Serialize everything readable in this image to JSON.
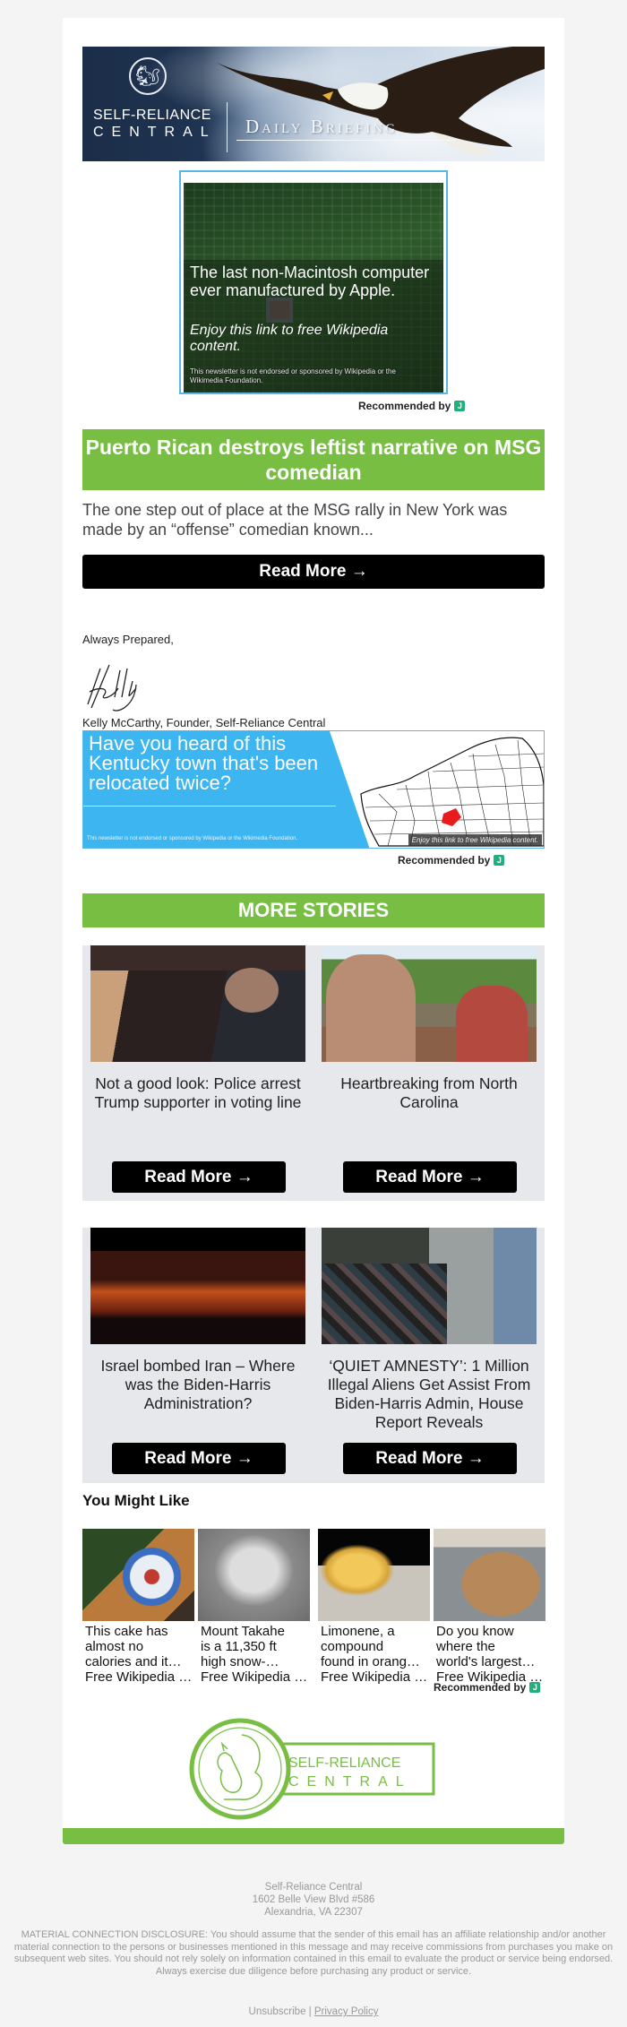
{
  "banner": {
    "brand_line1": "SELF-RELIANCE",
    "brand_line2": "CENTRAL",
    "title": "Daily Briefing"
  },
  "ad_top": {
    "title": "The last non-Macintosh computer ever manufactured by Apple.",
    "subtitle": "Enjoy this link to free Wikipedia content.",
    "disclaimer": "This newsletter is not endorsed or sponsored by Wikipedia or the Wikimedia Foundation.",
    "recommended_by": "Recommended by",
    "provider_icon": "J"
  },
  "main_story": {
    "headline": "Puerto Rican destroys leftist narrative on MSG comedian",
    "teaser": "The one step out of place at the MSG rally in New York was made by an “offense” comedian known...",
    "read_more": "Read More →"
  },
  "signoff": {
    "closing": "Always Prepared,",
    "signature": "Kelly",
    "name_line": "Kelly McCarthy, Founder, Self-Reliance Central"
  },
  "ad_kentucky": {
    "question": "Have you heard of this Kentucky town that's been relocated twice?",
    "disclaimer": "This newsletter is not endorsed or sponsored by Wikipedia or the Wikimedia Foundation.",
    "enjoy": "Enjoy this link to free Wikipedia content.",
    "recommended_by": "Recommended by",
    "provider_icon": "J"
  },
  "more_stories": {
    "heading": "MORE STORIES",
    "items": [
      {
        "title": "Not a good look: Police arrest Trump supporter in voting line",
        "read_more": "Read More →"
      },
      {
        "title": "Heartbreaking from North Carolina",
        "read_more": "Read More →"
      },
      {
        "title": "Israel bombed Iran – Where was the Biden-Harris Administration?",
        "read_more": "Read More →"
      },
      {
        "title": "‘QUIET AMNESTY’: 1 Million Illegal Aliens Get Assist From Biden-Harris Admin, House Report Reveals",
        "read_more": "Read More →"
      }
    ]
  },
  "you_might_like": {
    "heading": "You Might Like",
    "items": [
      {
        "caption": "This cake has\nalmost no\ncalories and it…",
        "source": "Free Wikipedia …"
      },
      {
        "caption": "Mount Takahe\nis a 11,350 ft\nhigh snow-…",
        "source": "Free Wikipedia …"
      },
      {
        "caption": "Limonene, a\ncompound\nfound in orang…",
        "source": "Free Wikipedia …"
      },
      {
        "caption": "Do you know\nwhere the\nworld's largest…",
        "source": "Free Wikipedia …"
      }
    ],
    "recommended_by": "Recommended by",
    "provider_icon": "J"
  },
  "logo": {
    "line1": "SELF-RELIANCE",
    "line2": "CENTRAL"
  },
  "footer": {
    "company": "Self-Reliance Central",
    "street": "1602 Belle View Blvd #586",
    "city": "Alexandria, VA 22307",
    "disclosure": "MATERIAL CONNECTION DISCLOSURE: You should assume that the sender of this email has an affiliate relationship and/or another material connection to the persons or businesses mentioned in this message and may receive commissions from purchases you make on subsequent web sites. You should not rely solely on information contained in this email to evaluate the product or service being endorsed. Always exercise due diligence before purchasing any product or service.",
    "unsubscribe": "Unsubscribe",
    "separator": "|",
    "privacy": "Privacy Policy"
  },
  "colors": {
    "brand_green": "#78be43",
    "ad_blue": "#3cb5f0",
    "card_bg": "#e6e8ec",
    "button_black": "#000000"
  }
}
